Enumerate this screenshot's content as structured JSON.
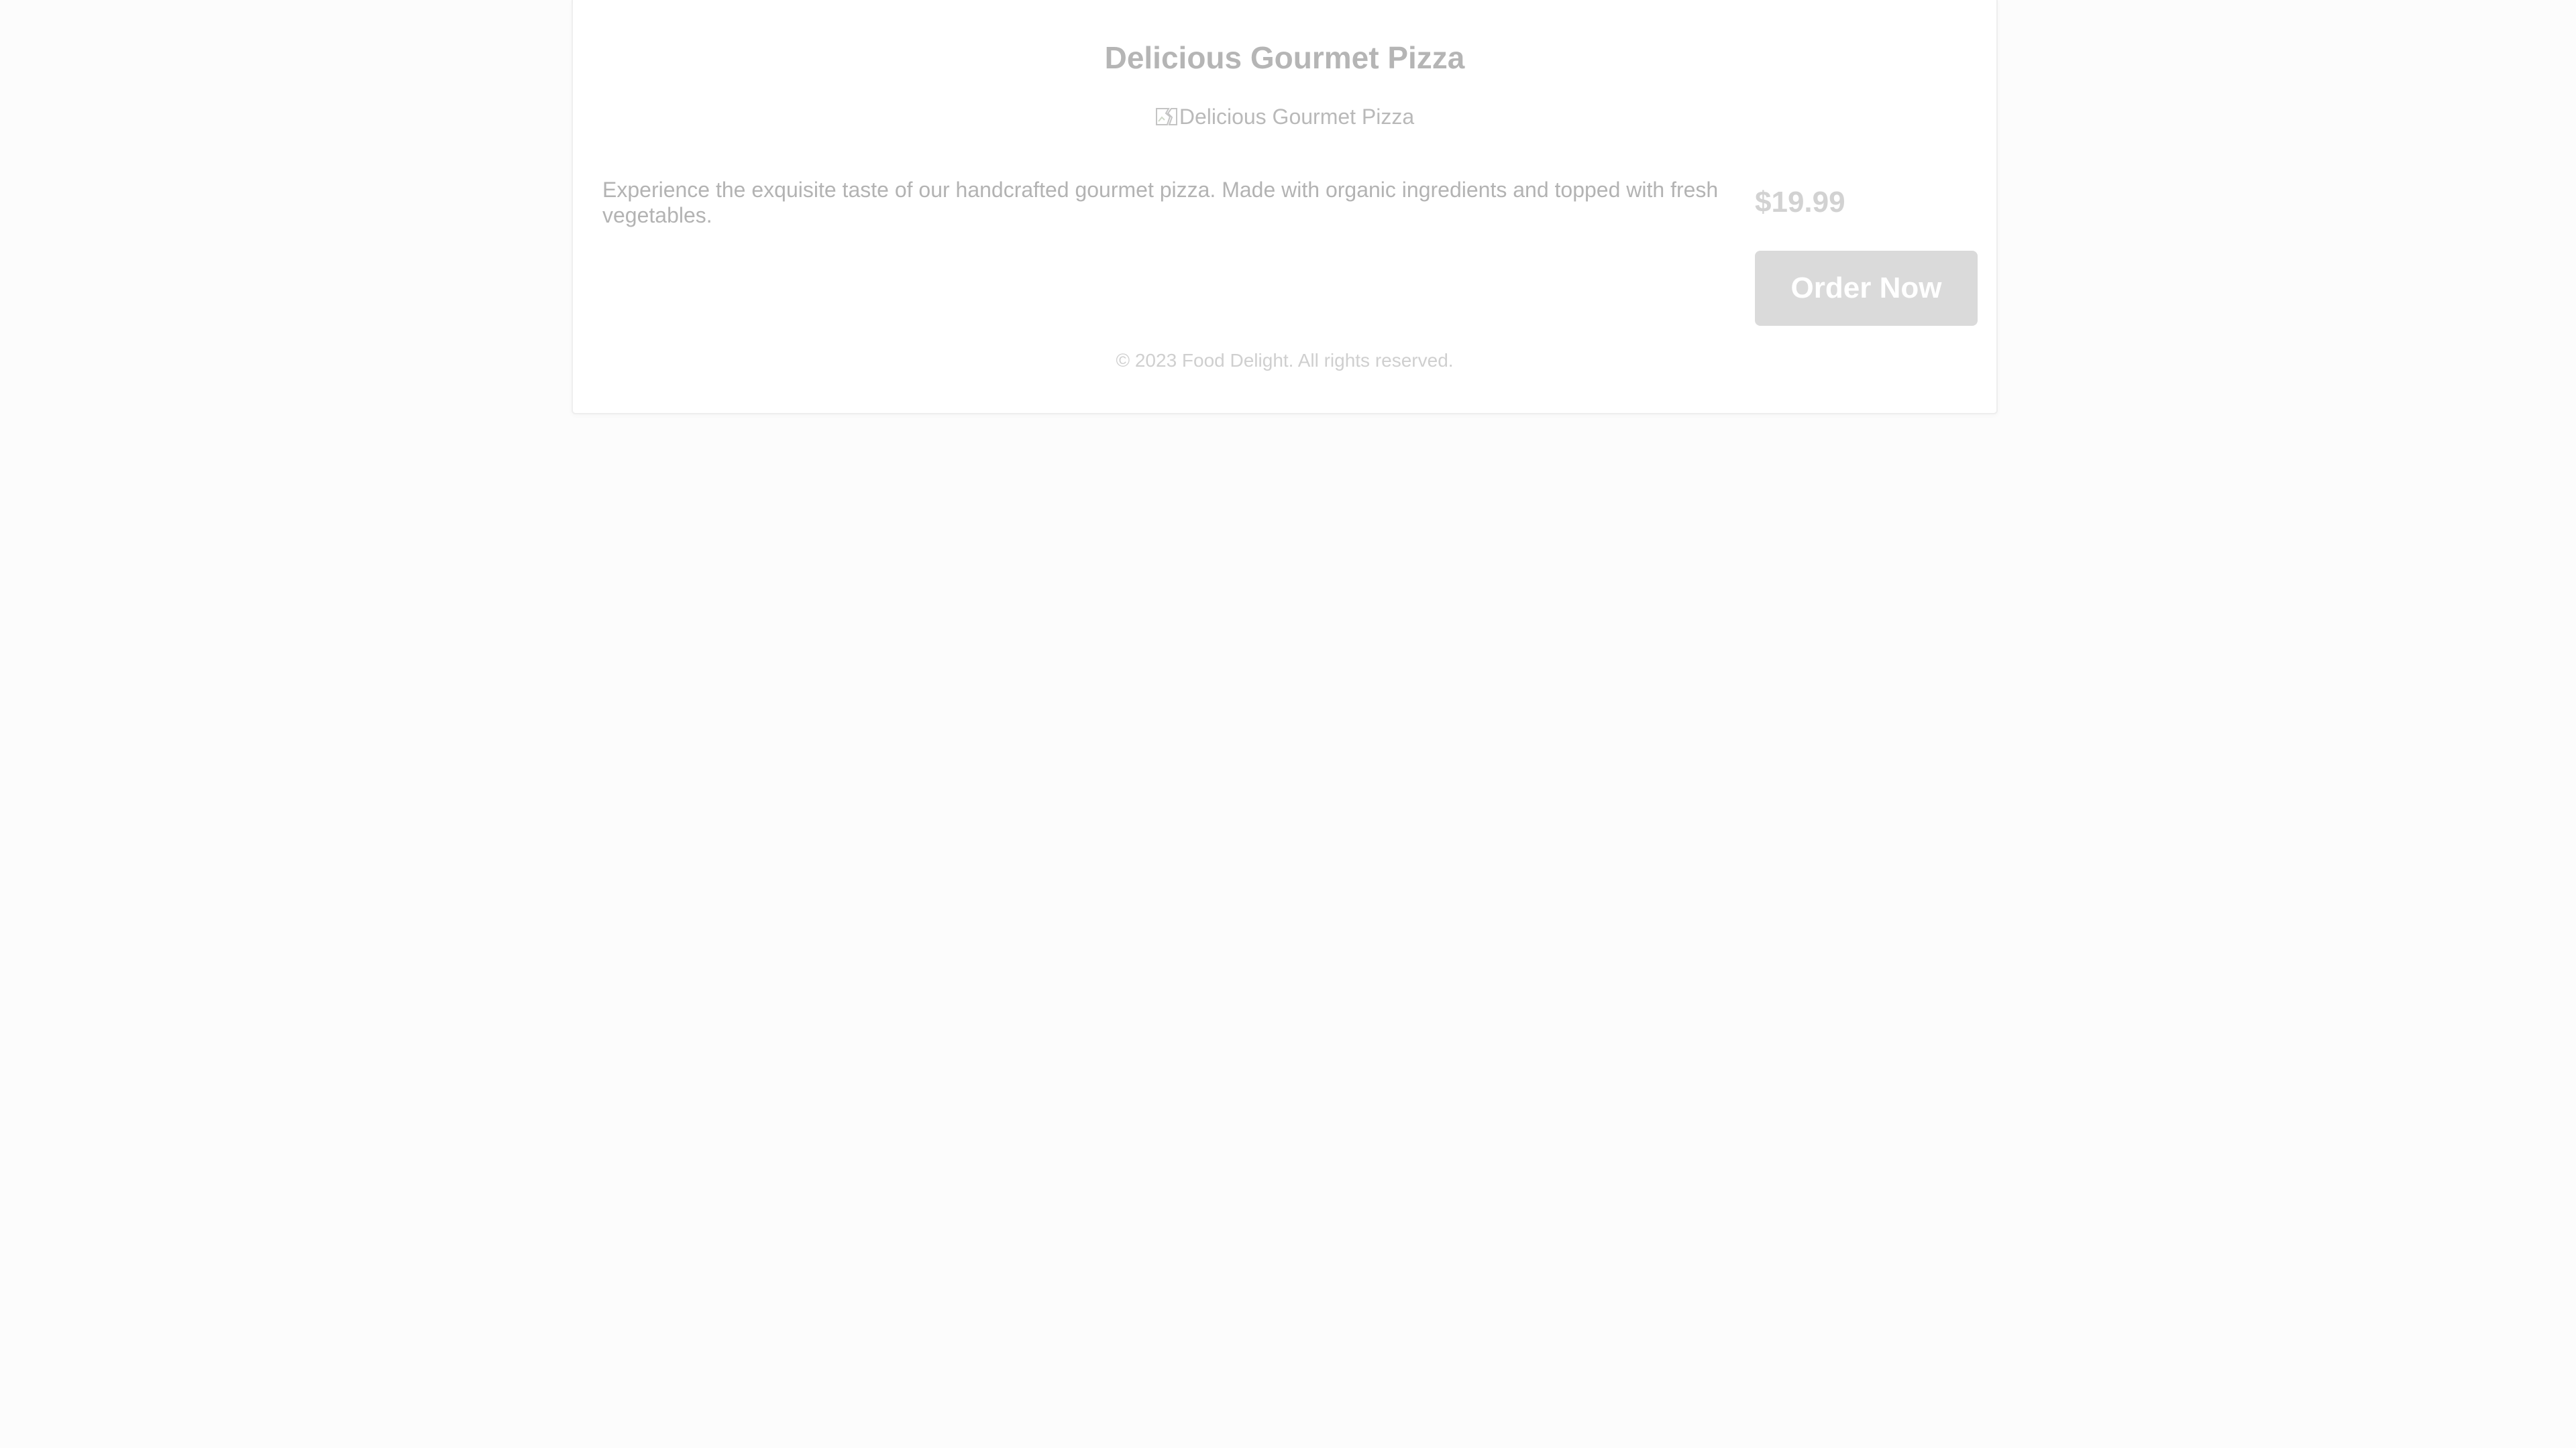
{
  "product": {
    "title": "Delicious Gourmet Pizza",
    "image_alt": "Delicious Gourmet Pizza",
    "description": "Experience the exquisite taste of our handcrafted gourmet pizza. Made with organic ingredients and topped with fresh vegetables.",
    "price": "$19.99",
    "order_label": "Order Now"
  },
  "footer": {
    "copyright": "© 2023 Food Delight. All rights reserved."
  },
  "colors": {
    "background": "#fcfcfc",
    "card": "#ffffff",
    "button": "#dadada",
    "text_muted": "#b3b3b3"
  }
}
